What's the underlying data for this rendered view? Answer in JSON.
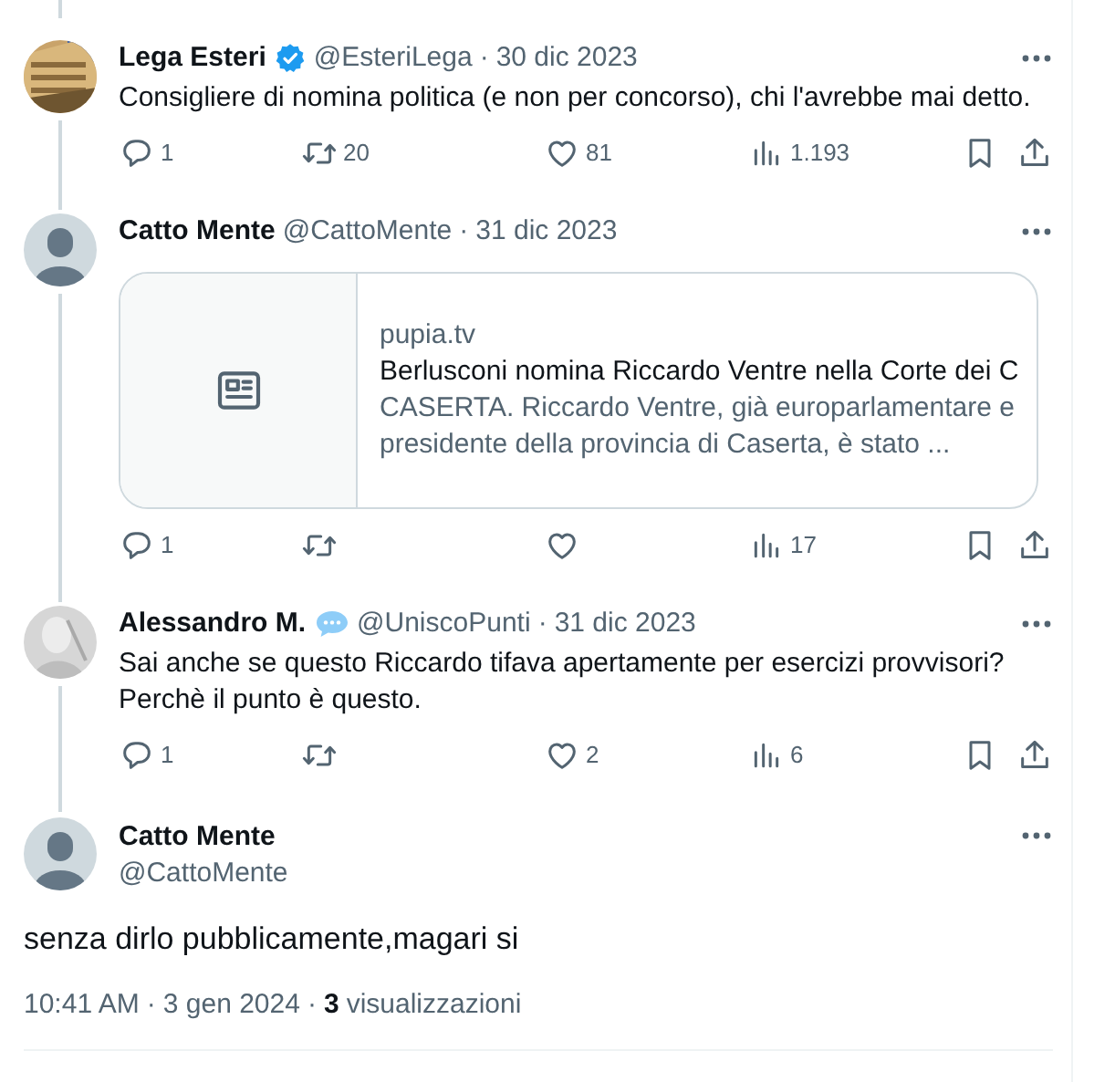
{
  "thread": [
    {
      "name": "Lega Esteri",
      "badge": {
        "kind": "verified"
      },
      "handle": "@EsteriLega",
      "separator": "·",
      "date": "30 dic 2023",
      "text": "Consigliere di nomina politica (e non per concorso), chi l'avrebbe mai detto.",
      "actions": {
        "replies": "1",
        "reposts": "20",
        "likes": "81",
        "views": "1.193"
      }
    },
    {
      "avatar": {
        "kind": "default"
      },
      "name": "Catto Mente",
      "handle": "@CattoMente",
      "separator": "·",
      "date": "31 dic 2023",
      "card": {
        "domain": "pupia.tv",
        "title": "Berlusconi nomina Riccardo Ventre nella Corte dei C",
        "description": "CASERTA. Riccardo Ventre, già europarlamentare e presidente della provincia di Caserta, è stato ..."
      },
      "actions": {
        "replies": "1",
        "views": "17"
      }
    },
    {
      "avatar": {
        "kind": "sketch"
      },
      "name": "Alessandro M.",
      "badge": {
        "kind": "chat"
      },
      "handle": "@UniscoPunti",
      "separator": "·",
      "date": "31 dic 2023",
      "text": "Sai anche se questo Riccardo tifava apertamente per esercizi provvisori? Perchè il punto è questo.",
      "actions": {
        "replies": "1",
        "likes": "2",
        "views": "6"
      }
    }
  ],
  "main": {
    "avatar": {
      "kind": "default"
    },
    "name": "Catto Mente",
    "handle": "@CattoMente",
    "text": "senza dirlo pubblicamente,magari si",
    "time": "10:41 AM",
    "separator_1": "·",
    "date": "3 gen 2024",
    "separator_2": "·",
    "views_count": "3",
    "views_label": "visualizzazioni"
  }
}
